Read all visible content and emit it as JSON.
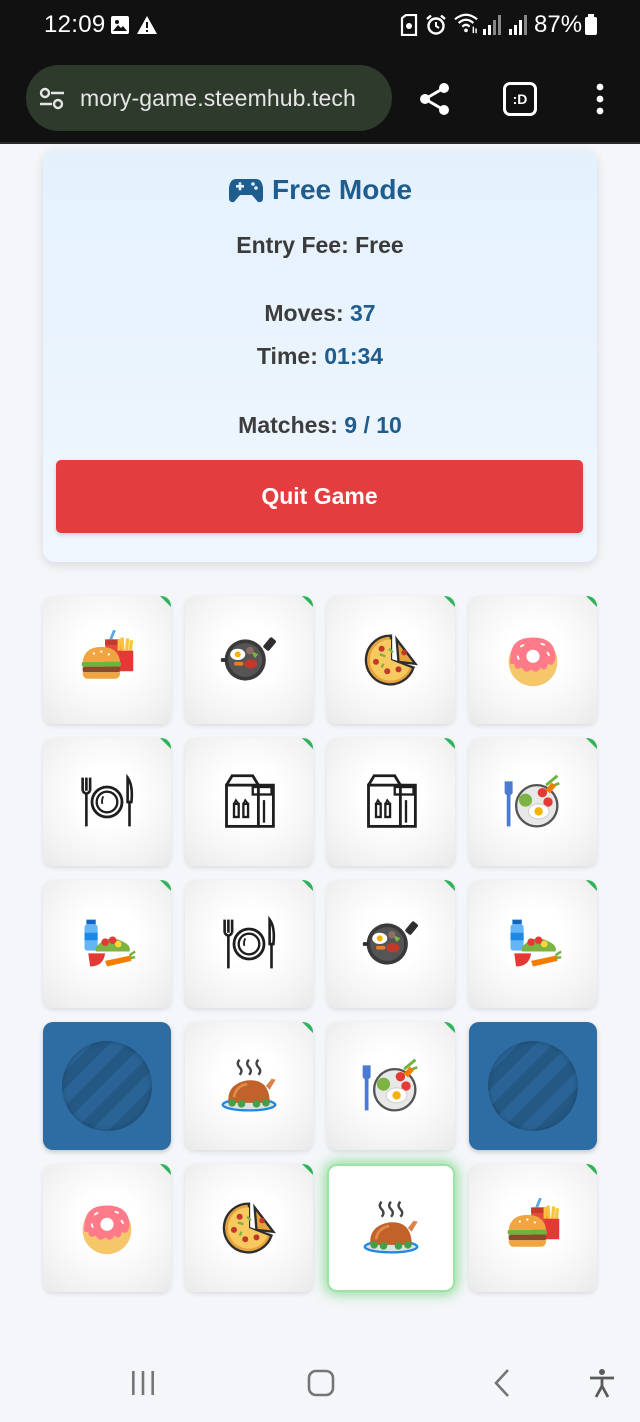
{
  "status_bar": {
    "time": "12:09",
    "battery": "87%",
    "icons": [
      "image-icon",
      "warning-icon",
      "sim-icon",
      "alarm-icon",
      "wifi-icon",
      "signal-icon",
      "signal-icon",
      "battery-icon"
    ]
  },
  "browser": {
    "url": "mory-game.steemhub.tech",
    "tab_label": ":D",
    "icons": [
      "site-settings-icon",
      "share-icon",
      "tab-switcher-icon",
      "more-vert-icon"
    ]
  },
  "game": {
    "mode_title": "Free Mode",
    "entry_fee": "Entry Fee: Free",
    "moves_label": "Moves: ",
    "moves_value": "37",
    "time_label": "Time: ",
    "time_value": "01:34",
    "matches_label": "Matches: ",
    "matches_value": "9 / 10",
    "quit_label": "Quit Game"
  },
  "cards": [
    {
      "icon": "burger-fries-soda-icon",
      "state": "matched"
    },
    {
      "icon": "breakfast-pan-icon",
      "state": "matched"
    },
    {
      "icon": "pizza-icon",
      "state": "matched"
    },
    {
      "icon": "donut-icon",
      "state": "matched"
    },
    {
      "icon": "plate-cutlery-icon",
      "state": "matched"
    },
    {
      "icon": "takeaway-bag-icon",
      "state": "matched"
    },
    {
      "icon": "takeaway-bag-icon",
      "state": "matched"
    },
    {
      "icon": "salad-bowl-egg-icon",
      "state": "matched"
    },
    {
      "icon": "groceries-bottle-icon",
      "state": "matched"
    },
    {
      "icon": "plate-cutlery-icon",
      "state": "matched"
    },
    {
      "icon": "breakfast-pan-icon",
      "state": "matched"
    },
    {
      "icon": "groceries-bottle-icon",
      "state": "matched"
    },
    {
      "icon": "card-back",
      "state": "facedown"
    },
    {
      "icon": "roast-chicken-icon",
      "state": "matched"
    },
    {
      "icon": "salad-bowl-egg-icon",
      "state": "matched"
    },
    {
      "icon": "card-back",
      "state": "facedown"
    },
    {
      "icon": "donut-icon",
      "state": "matched"
    },
    {
      "icon": "pizza-icon",
      "state": "matched"
    },
    {
      "icon": "roast-chicken-icon",
      "state": "selected"
    },
    {
      "icon": "burger-fries-soda-icon",
      "state": "matched"
    }
  ],
  "colors": {
    "accent": "#1e5d8e",
    "quit": "#e43d3f",
    "card_back": "#2e6da4",
    "match_marker": "#2fb35a"
  },
  "nav": {
    "icons": [
      "recents-icon",
      "home-icon",
      "back-icon",
      "accessibility-icon"
    ]
  }
}
